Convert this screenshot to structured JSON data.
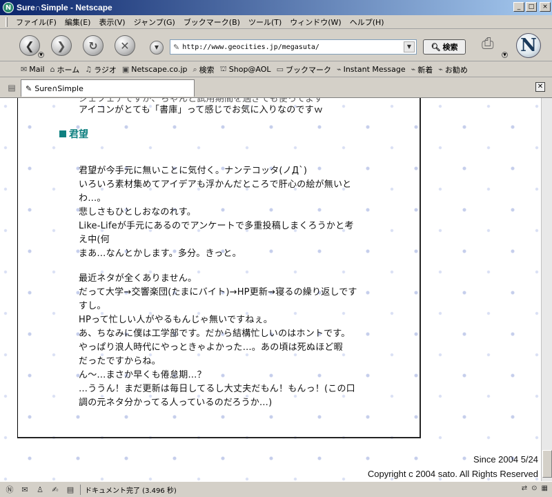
{
  "window": {
    "title": "Sure∩Simple - Netscape",
    "app_icon": "netscape-icon",
    "controls": [
      "_",
      "□",
      "×"
    ]
  },
  "menu": [
    "ファイル(F)",
    "編集(E)",
    "表示(V)",
    "ジャンプ(G)",
    "ブックマーク(B)",
    "ツール(T)",
    "ウィンドウ(W)",
    "ヘルプ(H)"
  ],
  "navbar": {
    "url": "http://www.geocities.jp/megasuta/",
    "search_label": "検索"
  },
  "personal_toolbar": [
    "Mail",
    "ホーム",
    "ラジオ",
    "Netscape.co.jp",
    "検索",
    "Shop@AOL",
    "ブックマーク",
    "Instant Message",
    "新着",
    "お勧め"
  ],
  "tab": {
    "label": "Sure∩Simple"
  },
  "page": {
    "top_partial_line": "ジェフェチですが、ちゃんと試用期間を過ぎても使ってます",
    "top_line": "アイコンがとても「書庫」って感じでお気に入りなのですｗ",
    "heading": "君望",
    "para1": [
      "君望が今手元に無いことに気付く。ナンテコッタ(ノД`)",
      "いろいろ素材集めてアイデアも浮かんだところで肝心の絵が無いと",
      "わ…。",
      "悲しさもひとしおなのれす。",
      "Like-Lifeが手元にあるのでアンケートで多重投稿しまくろうかと考",
      "え中(何",
      "まあ…なんとかします。多分。きっと。"
    ],
    "para2": [
      "最近ネタが全くありません。",
      "だって大学→交響楽団(たまにバイト)→HP更新→寝るの繰り返しです",
      "すし。",
      "HPって忙しい人がやるもんじゃ無いですねぇ。",
      "あ、ちなみに僕は工学部です。だから結構忙しいのはホントです。",
      "やっぱり浪人時代にやっときゃよかった…。あの頃は死ぬほど暇",
      "だったですからね。",
      "ん～…まさか早くも倦怠期…？",
      "…ううん！まだ更新は毎日してるし大丈夫だもん！もんっ！(この口",
      "調の元ネタ分かってる人っているのだろうか…)"
    ],
    "since": "Since 2004 5/24",
    "copyright": "Copyright c 2004 sato. All Rights Reserved"
  },
  "status": {
    "text": "ドキュメント完了 (3.496 秒)"
  }
}
